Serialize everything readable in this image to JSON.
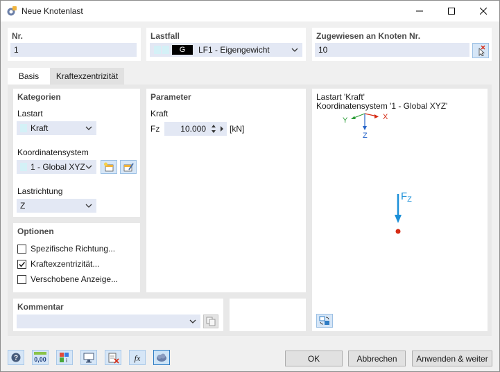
{
  "window": {
    "title": "Neue Knotenlast"
  },
  "nr": {
    "label": "Nr.",
    "value": "1"
  },
  "lastfall": {
    "label": "Lastfall",
    "badge": "G",
    "value": "LF1 - Eigengewicht"
  },
  "zugewiesen": {
    "label": "Zugewiesen an Knoten Nr.",
    "value": "10"
  },
  "tabs": [
    {
      "label": "Basis"
    },
    {
      "label": "Kraftexzentrizität"
    }
  ],
  "kategorien": {
    "title": "Kategorien",
    "lastart_label": "Lastart",
    "lastart_value": "Kraft",
    "koordinatensystem_label": "Koordinatensystem",
    "koordinatensystem_value": "1 - Global XYZ",
    "lastrichtung_label": "Lastrichtung",
    "lastrichtung_value": "Z"
  },
  "parameter": {
    "title": "Parameter",
    "kraft_label": "Kraft",
    "fz_label": "Fz",
    "fz_value": "10.000",
    "fz_unit": "[kN]"
  },
  "optionen": {
    "title": "Optionen",
    "items": [
      {
        "label": "Spezifische Richtung...",
        "checked": false
      },
      {
        "label": "Kraftexzentrizität...",
        "checked": true
      },
      {
        "label": "Verschobene Anzeige...",
        "checked": false
      }
    ]
  },
  "kommentar": {
    "title": "Kommentar",
    "value": ""
  },
  "preview": {
    "line1": "Lastart 'Kraft'",
    "line2": "Koordinatensystem '1 - Global XYZ'",
    "axis_x": "X",
    "axis_y": "Y",
    "axis_z": "Z",
    "force_label": "F",
    "force_sub": "Z"
  },
  "toolbar": {
    "units_text": "0,00"
  },
  "buttons": {
    "ok": "OK",
    "cancel": "Abbrechen",
    "apply": "Anwenden & weiter"
  },
  "colors": {
    "accent": "#2e7cc4",
    "field_bg": "#e3e8f4",
    "swatch": "#d4f1f7",
    "force": "#1a8fd8",
    "node": "#d62b14"
  }
}
